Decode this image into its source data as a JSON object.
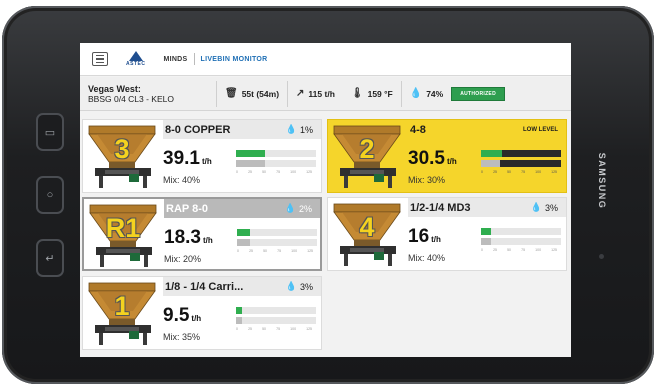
{
  "device": {
    "brand": "SAMSUNG",
    "side_buttons": [
      "▭",
      "○",
      "↵"
    ]
  },
  "nav": {
    "logo_text": "ASTEC",
    "minds": "MINDS",
    "livebin": "LIVEBIN MONITOR"
  },
  "info": {
    "plant_line1": "Vegas West:",
    "plant_line2": "BBSG 0/4 CL3 - KELO",
    "silo": "55t (54m)",
    "rate": "115 t/h",
    "temp": "159 °F",
    "moisture": "74%",
    "auth": "AUTHORIZED"
  },
  "tick_labels": [
    "0",
    "25",
    "50",
    "75",
    "100",
    "125"
  ],
  "bins": [
    {
      "number": "3",
      "name": "8-0 COPPER",
      "moisture": "1%",
      "rate": "39.1",
      "unit": "t/h",
      "mix": "Mix: 40%",
      "status": "",
      "target_fraction": 0.36,
      "actual_fraction": 0.36
    },
    {
      "number": "2",
      "name": "4-8",
      "moisture": "",
      "rate": "30.5",
      "unit": "t/h",
      "mix": "Mix: 30%",
      "status": "LOW LEVEL",
      "target_fraction": 0.26,
      "actual_fraction": 0.24
    },
    {
      "number": "R1",
      "name": "RAP 8-0",
      "moisture": "2%",
      "rate": "18.3",
      "unit": "t/h",
      "mix": "Mix: 20%",
      "status": "",
      "target_fraction": 0.16,
      "actual_fraction": 0.16
    },
    {
      "number": "4",
      "name": "1/2-1/4 MD3",
      "moisture": "3%",
      "rate": "16",
      "unit": "t/h",
      "mix": "Mix: 40%",
      "status": "",
      "target_fraction": 0.13,
      "actual_fraction": 0.13
    },
    {
      "number": "1",
      "name": "1/8 - 1/4 Carri...",
      "moisture": "3%",
      "rate": "9.5",
      "unit": "t/h",
      "mix": "Mix: 35%",
      "status": "",
      "target_fraction": 0.08,
      "actual_fraction": 0.08
    }
  ],
  "colors": {
    "accent": "#1f6fb5",
    "warning": "#f5d52b",
    "ok": "#2fae4f"
  }
}
